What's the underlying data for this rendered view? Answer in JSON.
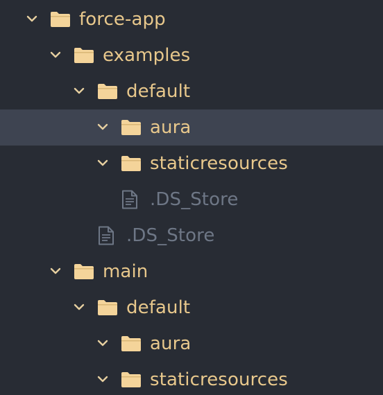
{
  "colors": {
    "background": "#282c34",
    "selected_row": "#3e4451",
    "folder_label": "#e8c88c",
    "folder_icon": "#f4d49a",
    "file_label": "#6e7786",
    "chevron": "#e6cfa0"
  },
  "tree": {
    "items": [
      {
        "label": "force-app",
        "type": "folder",
        "icon": "folder-icon",
        "expanded": true,
        "selected": false
      },
      {
        "label": "examples",
        "type": "folder",
        "icon": "folder-icon",
        "expanded": true,
        "selected": false
      },
      {
        "label": "default",
        "type": "folder",
        "icon": "folder-icon",
        "expanded": true,
        "selected": false
      },
      {
        "label": "aura",
        "type": "folder",
        "icon": "folder-icon",
        "expanded": true,
        "selected": true
      },
      {
        "label": "staticresources",
        "type": "folder",
        "icon": "folder-icon",
        "expanded": true,
        "selected": false
      },
      {
        "label": ".DS_Store",
        "type": "file",
        "icon": "file-text-icon",
        "selected": false
      },
      {
        "label": ".DS_Store",
        "type": "file",
        "icon": "file-text-icon",
        "selected": false
      },
      {
        "label": "main",
        "type": "folder",
        "icon": "folder-icon",
        "expanded": true,
        "selected": false
      },
      {
        "label": "default",
        "type": "folder",
        "icon": "folder-icon",
        "expanded": true,
        "selected": false
      },
      {
        "label": "aura",
        "type": "folder",
        "icon": "folder-icon",
        "expanded": true,
        "selected": false
      },
      {
        "label": "staticresources",
        "type": "folder",
        "icon": "folder-icon",
        "expanded": true,
        "selected": false
      }
    ]
  }
}
